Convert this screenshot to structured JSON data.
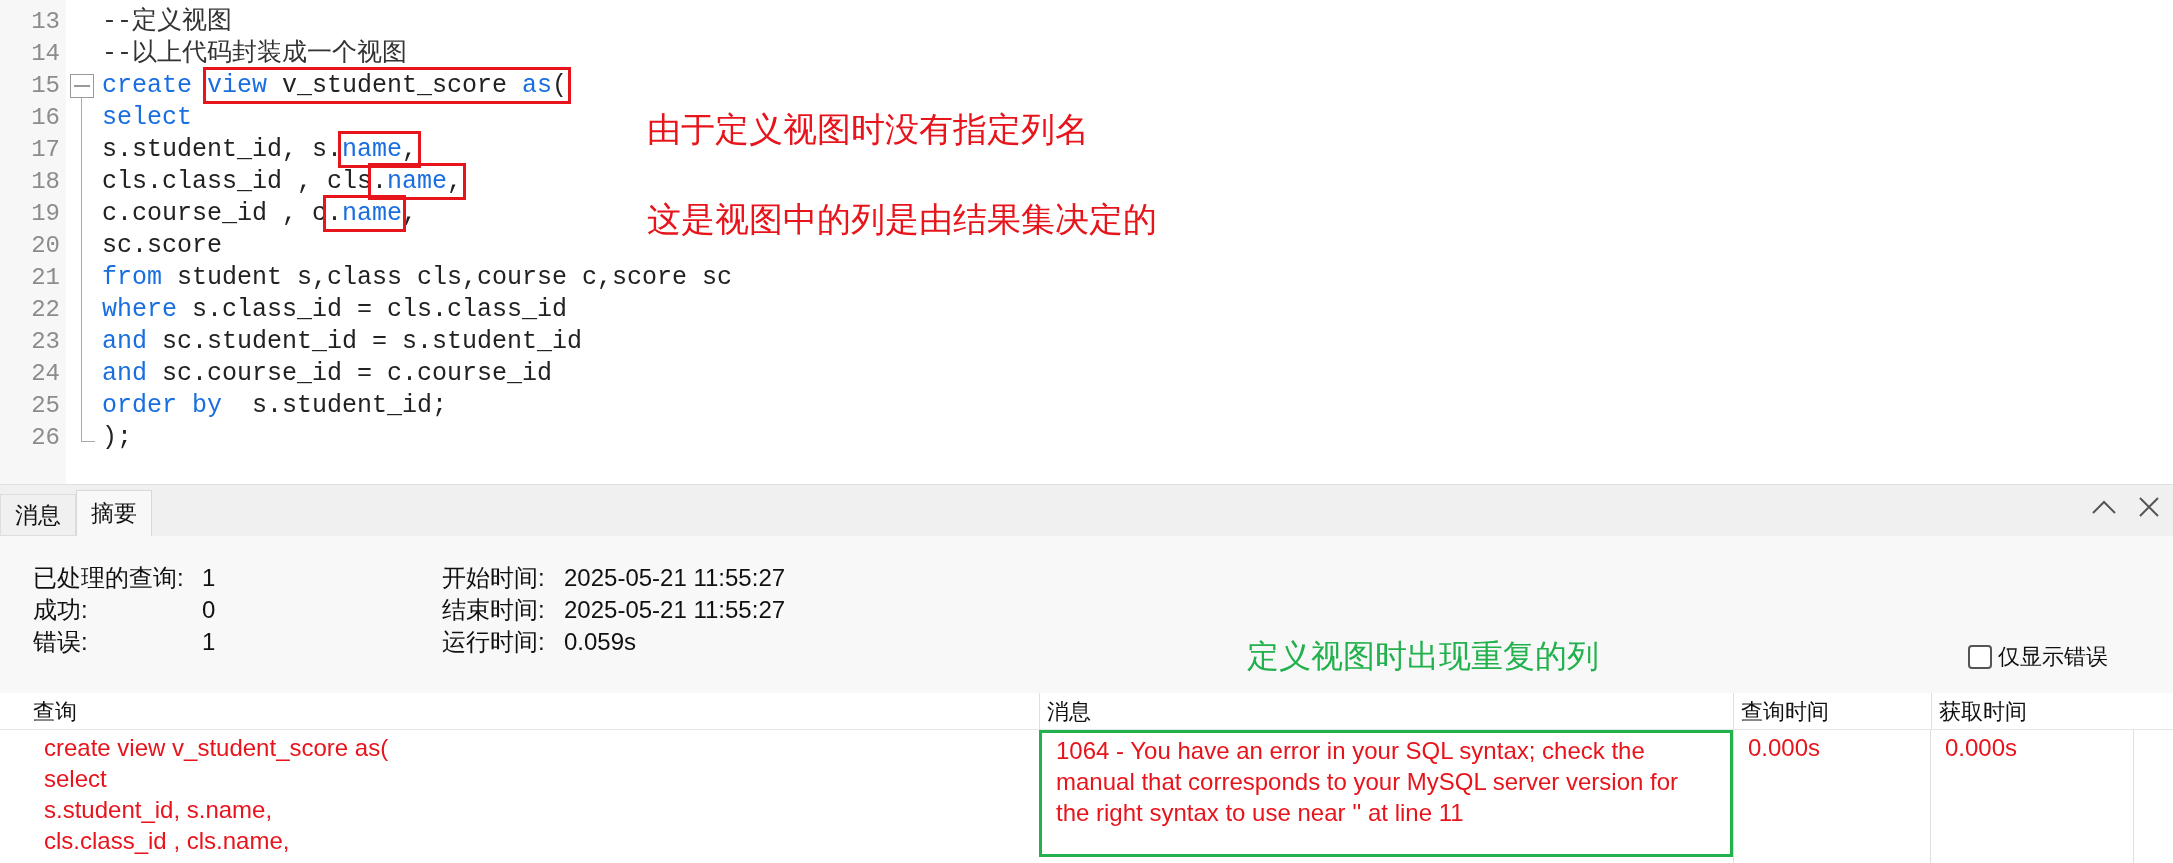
{
  "editor": {
    "lines": [
      {
        "number": "13",
        "kind": "plain",
        "tokens": [
          {
            "text": "--定义视图",
            "kind": "comment"
          }
        ]
      },
      {
        "number": "14",
        "kind": "plain",
        "tokens": [
          {
            "text": "--以上代码封装成一个视图",
            "kind": "comment"
          }
        ]
      },
      {
        "number": "15",
        "kind": "fold_start",
        "tokens": [
          {
            "text": "create ",
            "kind": "keyword"
          },
          {
            "kind": "highlight",
            "tokens": [
              {
                "text": "view",
                "kind": "keyword"
              },
              {
                "text": " v_student_score ",
                "kind": "plain"
              },
              {
                "text": "as",
                "kind": "keyword"
              },
              {
                "text": "(",
                "kind": "plain"
              }
            ]
          }
        ]
      },
      {
        "number": "16",
        "kind": "fold_body",
        "tokens": [
          {
            "text": "select",
            "kind": "keyword"
          }
        ]
      },
      {
        "number": "17",
        "kind": "fold_body",
        "tokens": [
          {
            "text": "s.student_id, s.",
            "kind": "plain"
          },
          {
            "kind": "highlight",
            "tokens": [
              {
                "text": "name",
                "kind": "keyword"
              },
              {
                "text": ",",
                "kind": "plain"
              }
            ]
          }
        ]
      },
      {
        "number": "18",
        "kind": "fold_body",
        "tokens": [
          {
            "text": "cls.class_id , cls",
            "kind": "plain"
          },
          {
            "kind": "highlight",
            "tokens": [
              {
                "text": ".",
                "kind": "plain"
              },
              {
                "text": "name",
                "kind": "keyword"
              },
              {
                "text": ",",
                "kind": "plain"
              }
            ]
          }
        ]
      },
      {
        "number": "19",
        "kind": "fold_body",
        "tokens": [
          {
            "text": "c.course_id , c",
            "kind": "plain"
          },
          {
            "kind": "highlight",
            "tokens": [
              {
                "text": ".",
                "kind": "plain"
              },
              {
                "text": "name",
                "kind": "keyword"
              }
            ]
          },
          {
            "text": ",",
            "kind": "plain"
          }
        ]
      },
      {
        "number": "20",
        "kind": "fold_body",
        "tokens": [
          {
            "text": "sc.score",
            "kind": "plain"
          }
        ]
      },
      {
        "number": "21",
        "kind": "fold_body",
        "tokens": [
          {
            "text": "from",
            "kind": "keyword"
          },
          {
            "text": " student s,class cls,course c,score sc",
            "kind": "plain"
          }
        ]
      },
      {
        "number": "22",
        "kind": "fold_body",
        "tokens": [
          {
            "text": "where",
            "kind": "keyword"
          },
          {
            "text": " s.class_id = cls.class_id",
            "kind": "plain"
          }
        ]
      },
      {
        "number": "23",
        "kind": "fold_body",
        "tokens": [
          {
            "text": "and",
            "kind": "keyword"
          },
          {
            "text": " sc.student_id = s.student_id",
            "kind": "plain"
          }
        ]
      },
      {
        "number": "24",
        "kind": "fold_body",
        "tokens": [
          {
            "text": "and",
            "kind": "keyword"
          },
          {
            "text": " sc.course_id = c.course_id",
            "kind": "plain"
          }
        ]
      },
      {
        "number": "25",
        "kind": "fold_body",
        "tokens": [
          {
            "text": "order by",
            "kind": "keyword"
          },
          {
            "text": "  s.student_id;",
            "kind": "plain"
          }
        ]
      },
      {
        "number": "26",
        "kind": "fold_end",
        "tokens": [
          {
            "text": ");",
            "kind": "plain"
          }
        ]
      }
    ],
    "annotations": [
      "由于定义视图时没有指定列名",
      "这是视图中的列是由结果集决定的"
    ]
  },
  "results": {
    "tabs": [
      {
        "label": "消息",
        "selected": false
      },
      {
        "label": "摘要",
        "selected": true
      }
    ],
    "summary": [
      {
        "label": "已处理的查询:",
        "value": "1"
      },
      {
        "label": "成功:",
        "value": "0"
      },
      {
        "label": "错误:",
        "value": "1"
      }
    ],
    "timing": [
      {
        "label": "开始时间:",
        "value": "2025-05-21 11:55:27"
      },
      {
        "label": "结束时间:",
        "value": "2025-05-21 11:55:27"
      },
      {
        "label": "运行时间:",
        "value": "0.059s"
      }
    ],
    "annotation": "定义视图时出现重复的列",
    "errors_only": {
      "label": "仅显示错误",
      "checked": false
    },
    "table": {
      "columns": [
        "查询",
        "消息",
        "查询时间",
        "获取时间"
      ],
      "rows": [
        {
          "query": [
            "create view v_student_score as(",
            "select",
            "s.student_id, s.name,",
            "cls.class_id , cls.name,"
          ],
          "message": "1064 - You have an error in your SQL syntax; check the manual that corresponds to your MySQL server version for the right syntax to use near '' at line 11",
          "query_time": "0.000s",
          "fetch_time": "0.000s",
          "error": true,
          "highlighted": true
        }
      ]
    }
  }
}
